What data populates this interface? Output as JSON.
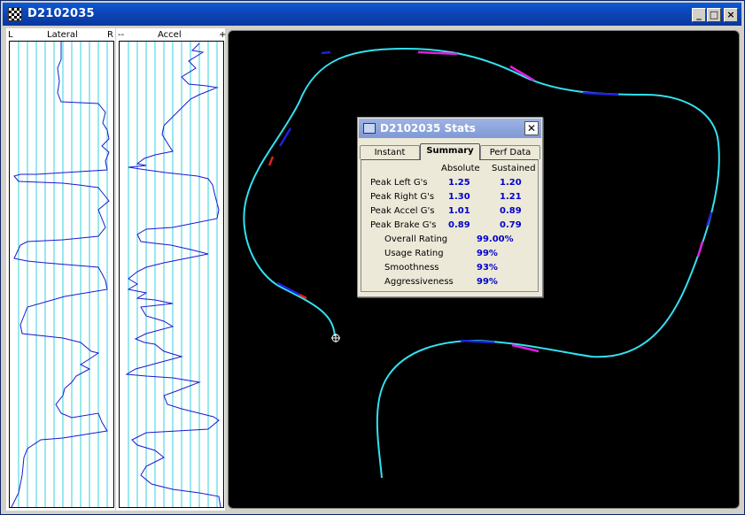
{
  "window": {
    "title": "D2102035"
  },
  "strips": {
    "lateral": {
      "left": "L",
      "title": "Lateral",
      "right": "R"
    },
    "accel": {
      "left": "--",
      "title": "Accel",
      "right": "+"
    }
  },
  "stats": {
    "title": "D2102035 Stats",
    "tabs": [
      "Instant",
      "Summary",
      "Perf Data"
    ],
    "active_tab": "Summary",
    "col_absolute": "Absolute",
    "col_sustained": "Sustained",
    "peaks": [
      {
        "label": "Peak Left G's",
        "absolute": "1.25",
        "sustained": "1.20"
      },
      {
        "label": "Peak Right G's",
        "absolute": "1.30",
        "sustained": "1.21"
      },
      {
        "label": "Peak Accel G's",
        "absolute": "1.01",
        "sustained": "0.89"
      },
      {
        "label": "Peak Brake G's",
        "absolute": "0.89",
        "sustained": "0.79"
      }
    ],
    "ratings": [
      {
        "label": "Overall Rating",
        "value": "99.00%"
      },
      {
        "label": "Usage Rating",
        "value": "99%"
      },
      {
        "label": "Smoothness",
        "value": "93%"
      },
      {
        "label": "Aggressiveness",
        "value": "99%"
      }
    ]
  },
  "colors": {
    "track": "#33e0f0",
    "track_alt": "#2020e0",
    "magenta": "#e020e0",
    "red": "#e02020",
    "trace": "#1a1ad0",
    "grid": "#33d0e0"
  }
}
